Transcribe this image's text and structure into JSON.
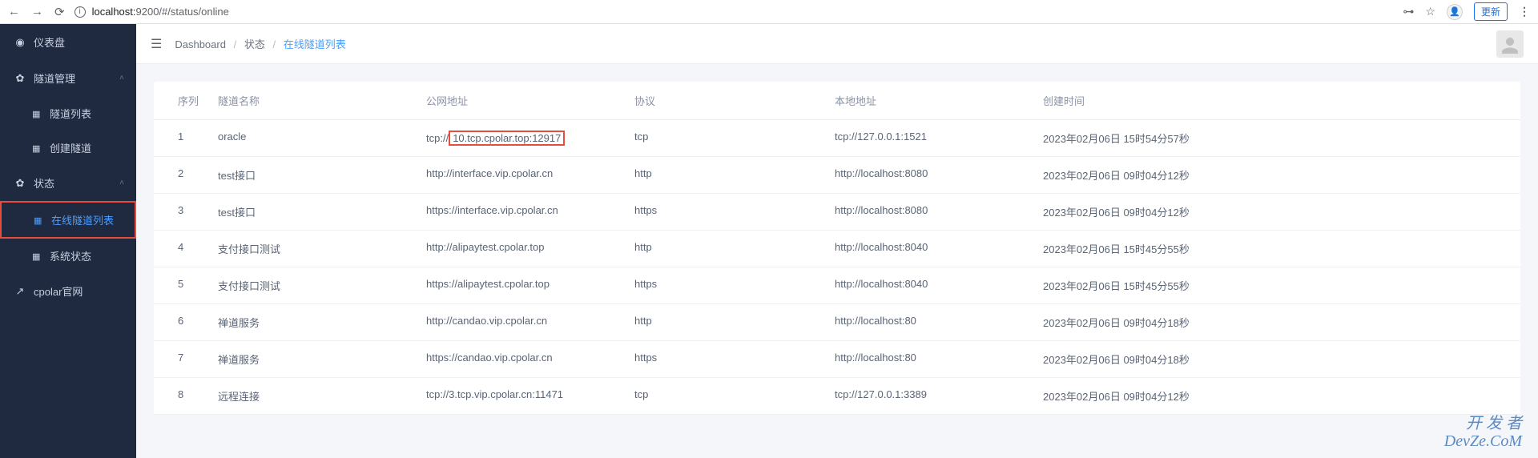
{
  "browser": {
    "url_host": "localhost:",
    "url_port": "9200",
    "url_path": "/#/status/online",
    "update_label": "更新",
    "menu_dots": "⋮"
  },
  "sidebar": {
    "items": [
      {
        "icon": "◉",
        "label": "仪表盘",
        "type": "item"
      },
      {
        "icon": "✿",
        "label": "隧道管理",
        "type": "expandable",
        "expanded": true
      },
      {
        "icon": "▦",
        "label": "隧道列表",
        "type": "sub"
      },
      {
        "icon": "▦",
        "label": "创建隧道",
        "type": "sub"
      },
      {
        "icon": "✿",
        "label": "状态",
        "type": "expandable",
        "expanded": true
      },
      {
        "icon": "▦",
        "label": "在线隧道列表",
        "type": "sub",
        "active": true
      },
      {
        "icon": "▦",
        "label": "系统状态",
        "type": "sub"
      },
      {
        "icon": "↗",
        "label": "cpolar官网",
        "type": "item"
      }
    ]
  },
  "breadcrumb": {
    "items": [
      "Dashboard",
      "状态",
      "在线隧道列表"
    ]
  },
  "table": {
    "headers": {
      "seq": "序列",
      "name": "隧道名称",
      "public": "公网地址",
      "proto": "协议",
      "local": "本地地址",
      "time": "创建时间"
    },
    "rows": [
      {
        "seq": "1",
        "name": "oracle",
        "public_prefix": "tcp://",
        "public_highlight": "10.tcp.cpolar.top:12917",
        "proto": "tcp",
        "local": "tcp://127.0.0.1:1521",
        "time": "2023年02月06日 15时54分57秒"
      },
      {
        "seq": "2",
        "name": "test接口",
        "public": "http://interface.vip.cpolar.cn",
        "proto": "http",
        "local": "http://localhost:8080",
        "time": "2023年02月06日 09时04分12秒"
      },
      {
        "seq": "3",
        "name": "test接口",
        "public": "https://interface.vip.cpolar.cn",
        "proto": "https",
        "local": "http://localhost:8080",
        "time": "2023年02月06日 09时04分12秒"
      },
      {
        "seq": "4",
        "name": "支付接口测试",
        "public": "http://alipaytest.cpolar.top",
        "proto": "http",
        "local": "http://localhost:8040",
        "time": "2023年02月06日 15时45分55秒"
      },
      {
        "seq": "5",
        "name": "支付接口测试",
        "public": "https://alipaytest.cpolar.top",
        "proto": "https",
        "local": "http://localhost:8040",
        "time": "2023年02月06日 15时45分55秒"
      },
      {
        "seq": "6",
        "name": "禅道服务",
        "public": "http://candao.vip.cpolar.cn",
        "proto": "http",
        "local": "http://localhost:80",
        "time": "2023年02月06日 09时04分18秒"
      },
      {
        "seq": "7",
        "name": "禅道服务",
        "public": "https://candao.vip.cpolar.cn",
        "proto": "https",
        "local": "http://localhost:80",
        "time": "2023年02月06日 09时04分18秒"
      },
      {
        "seq": "8",
        "name": "远程连接",
        "public": "tcp://3.tcp.vip.cpolar.cn:11471",
        "proto": "tcp",
        "local": "tcp://127.0.0.1:3389",
        "time": "2023年02月06日 09时04分12秒"
      }
    ]
  },
  "watermark": {
    "line1": "开 发 者",
    "line2": "DevZe.CoM"
  }
}
